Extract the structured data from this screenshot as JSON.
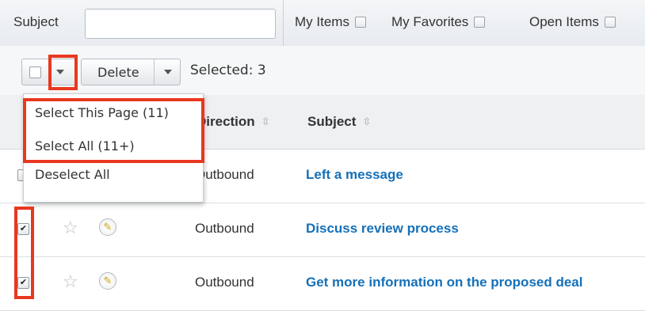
{
  "filter_bar": {
    "subject_label": "Subject",
    "subject_value": "",
    "my_items_label": "My Items",
    "my_favorites_label": "My Favorites",
    "open_items_label": "Open Items"
  },
  "action_bar": {
    "delete_label": "Delete",
    "selected_text": "Selected: 3"
  },
  "select_menu": {
    "items": [
      "Select This Page (11)",
      "Select All (11+)",
      "Deselect All"
    ]
  },
  "table": {
    "columns": [
      "Direction",
      "Subject"
    ],
    "rows": [
      {
        "direction": "Outbound",
        "subject": "Left a message",
        "checked": false
      },
      {
        "direction": "Outbound",
        "subject": "Discuss review process",
        "checked": true
      },
      {
        "direction": "Outbound",
        "subject": "Get more information on the proposed deal",
        "checked": true
      }
    ]
  },
  "icons": {
    "sort": "sort-arrows-icon",
    "favorite": "star-icon",
    "edit": "pencil-icon",
    "checkmark": "✔"
  },
  "colors": {
    "link": "#1570b8",
    "highlight": "#e8381f"
  }
}
